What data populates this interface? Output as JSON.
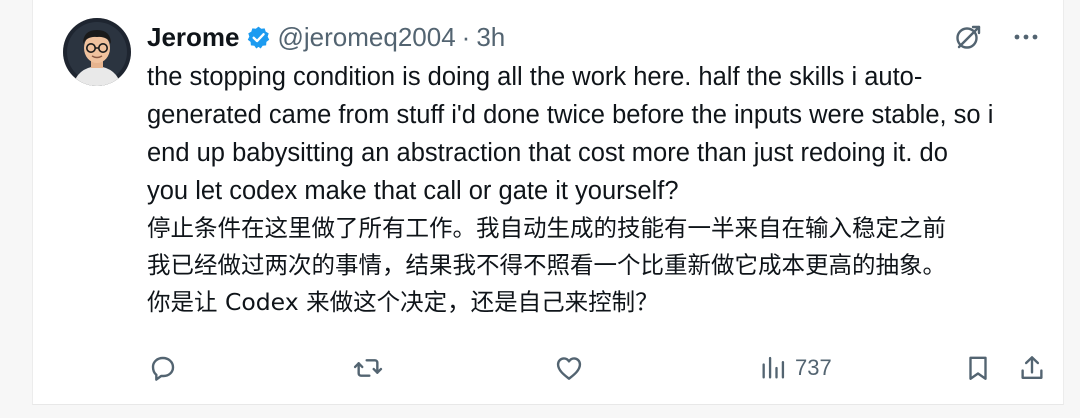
{
  "author": {
    "display_name": "Jerome",
    "handle": "@jeromeq2004",
    "separator": "·",
    "time": "3h"
  },
  "tweet": {
    "english_lines": [
      "the stopping condition is doing all the work here. half the skills i auto-",
      "generated came from stuff i'd done twice before the inputs were stable, so i",
      "end up babysitting an abstraction that cost more than just redoing it. do",
      "you let codex make that call or gate it yourself?"
    ],
    "chinese_lines": [
      "停止条件在这里做了所有工作。我自动生成的技能有一半来自在输入稳定之前",
      "我已经做过两次的事情，结果我不得不照看一个比重新做它成本更高的抽象。",
      "你是让 Codex 来做这个决定，还是自己来控制？"
    ]
  },
  "actions": {
    "views": "737"
  },
  "icons": {
    "top": [
      "grok-icon",
      "more-icon"
    ],
    "bar": [
      "reply-icon",
      "retweet-icon",
      "like-icon",
      "views-icon",
      "bookmark-icon",
      "share-icon"
    ]
  },
  "colors": {
    "verified": "#1d9bf0",
    "text": "#0f1419",
    "muted": "#536471"
  }
}
